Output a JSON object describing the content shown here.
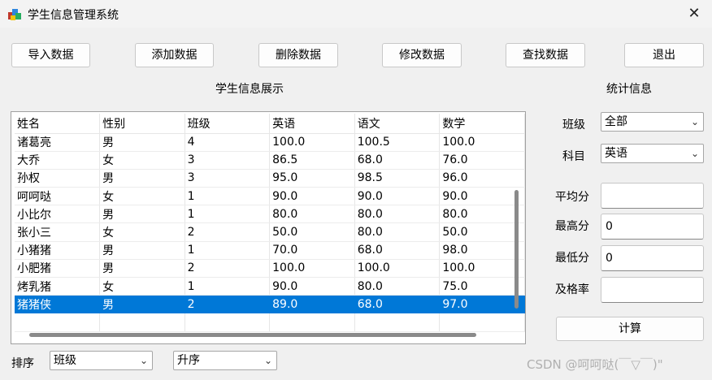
{
  "window": {
    "title": "学生信息管理系统",
    "close_icon": "close-icon"
  },
  "toolbar": {
    "import": "导入数据",
    "add": "添加数据",
    "delete": "删除数据",
    "modify": "修改数据",
    "find": "查找数据",
    "exit": "退出"
  },
  "main": {
    "display_title": "学生信息展示",
    "columns": [
      "姓名",
      "性别",
      "班级",
      "英语",
      "语文",
      "数学"
    ],
    "rows": [
      [
        "诸葛亮",
        "男",
        "4",
        "100.0",
        "100.5",
        "100.0"
      ],
      [
        "大乔",
        "女",
        "3",
        "86.5",
        "68.0",
        "76.0"
      ],
      [
        "孙权",
        "男",
        "3",
        "95.0",
        "98.5",
        "96.0"
      ],
      [
        "呵呵哒",
        "女",
        "1",
        "90.0",
        "90.0",
        "90.0"
      ],
      [
        "小比尔",
        "男",
        "1",
        "80.0",
        "80.0",
        "80.0"
      ],
      [
        "张小三",
        "女",
        "2",
        "50.0",
        "80.0",
        "50.0"
      ],
      [
        "小猪猪",
        "男",
        "1",
        "70.0",
        "68.0",
        "98.0"
      ],
      [
        "小肥猪",
        "男",
        "2",
        "100.0",
        "100.0",
        "100.0"
      ],
      [
        "烤乳猪",
        "女",
        "1",
        "90.0",
        "80.0",
        "75.0"
      ],
      [
        "猪猪侠",
        "男",
        "2",
        "89.0",
        "68.0",
        "97.0"
      ]
    ],
    "selected_row": 9,
    "selected_color": "#0078d7"
  },
  "sort": {
    "label": "排序",
    "field": "班级",
    "order": "升序"
  },
  "stats": {
    "title": "统计信息",
    "class_label": "班级",
    "class_value": "全部",
    "subject_label": "科目",
    "subject_value": "英语",
    "avg_label": "平均分",
    "avg_value": "",
    "max_label": "最高分",
    "max_value": "0",
    "min_label": "最低分",
    "min_value": "0",
    "pass_label": "及格率",
    "pass_value": "",
    "calc_button": "计算"
  },
  "watermark": "CSDN @呵呵哒(￣▽￣)\""
}
